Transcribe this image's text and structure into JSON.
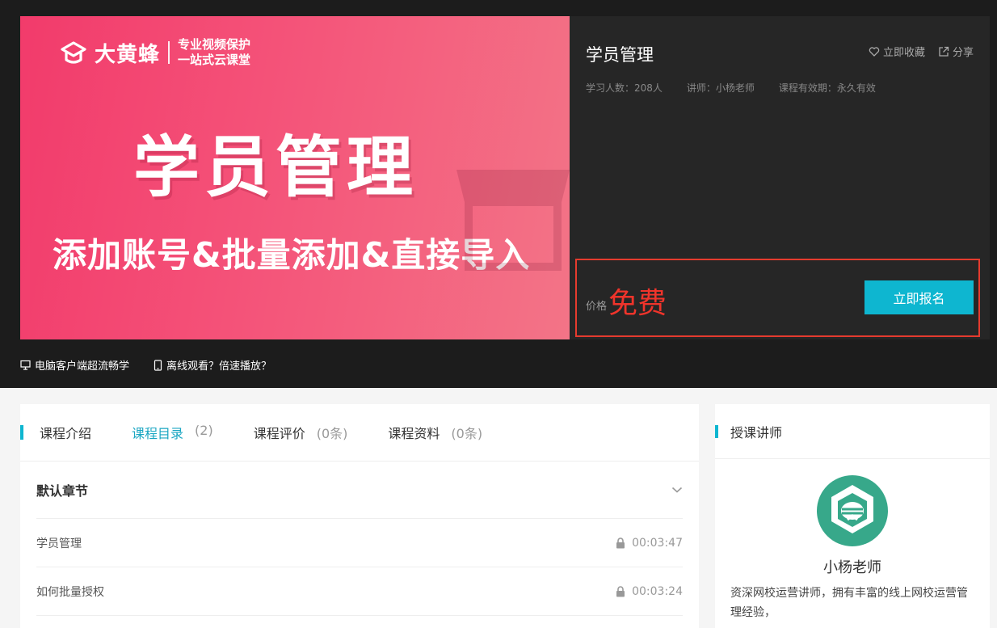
{
  "banner": {
    "logo_name": "大黄蜂",
    "logo_tag_line1": "专业视频保护",
    "logo_tag_line2": "一站式云课堂",
    "title": "学员管理",
    "subtitle": "添加账号&批量添加&直接导入"
  },
  "course": {
    "title": "学员管理",
    "favorite_label": "立即收藏",
    "share_label": "分享",
    "learners": "学习人数：208人",
    "teacher": "讲师：小杨老师",
    "validity": "课程有效期：永久有效",
    "price_label": "价格",
    "price_value": "免费",
    "enroll_label": "立即报名"
  },
  "tips": {
    "desktop": "电脑客户端超流畅学",
    "offline": "离线观看？倍速播放？"
  },
  "tabs": [
    {
      "label": "课程介绍",
      "count": ""
    },
    {
      "label": "课程目录",
      "count": "(2)"
    },
    {
      "label": "课程评价",
      "count": "(0条)"
    },
    {
      "label": "课程资料",
      "count": "(0条)"
    }
  ],
  "chapter": {
    "title": "默认章节",
    "lessons": [
      {
        "title": "学员管理",
        "duration": "00:03:47"
      },
      {
        "title": "如何批量授权",
        "duration": "00:03:24"
      }
    ]
  },
  "instructor": {
    "heading": "授课讲师",
    "name": "小杨老师",
    "desc": "资深网校运营讲师，拥有丰富的线上网校运营管理经验，"
  },
  "colors": {
    "accent": "#0eb6d0",
    "price": "#f0342b",
    "highlight_border": "#e53b2e"
  }
}
